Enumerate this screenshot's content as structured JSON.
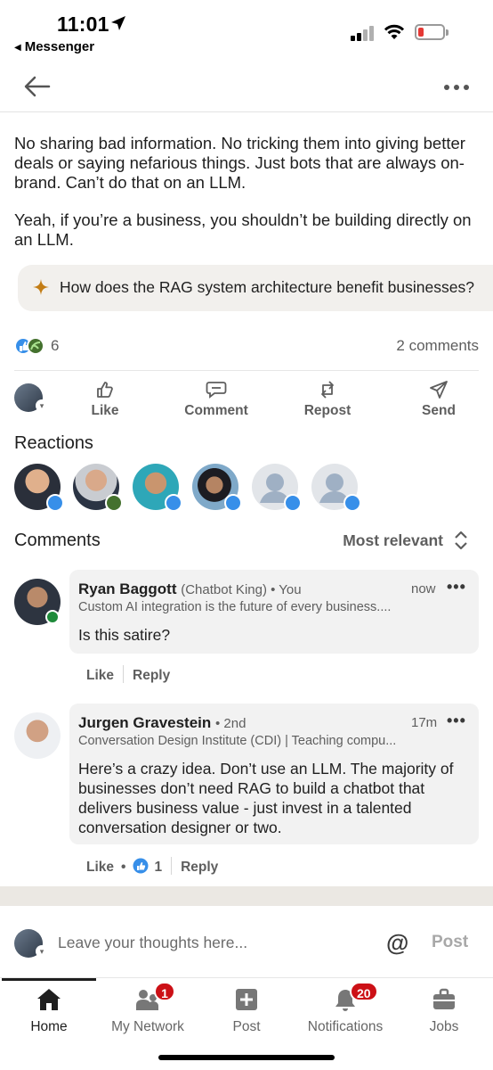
{
  "status_bar": {
    "time": "11:01",
    "back_app": "Messenger"
  },
  "post": {
    "paragraphs": [
      "No sharing bad information. No tricking them into giving better deals or saying nefarious things. Just bots that are always on-brand. Can’t do that on an LLM.",
      "Yeah, if you’re a business, you shouldn’t be building directly on an LLM."
    ],
    "ai_suggestion": "How does the RAG system architecture benefit businesses?",
    "reaction_count": "6",
    "comment_count": "2 comments"
  },
  "actions": {
    "like": "Like",
    "comment": "Comment",
    "repost": "Repost",
    "send": "Send"
  },
  "reactions": {
    "title": "Reactions"
  },
  "comments_section": {
    "title": "Comments",
    "sort_label": "Most relevant",
    "comments": [
      {
        "name": "Ryan Baggott",
        "meta": "(Chatbot King) • You",
        "time": "now",
        "headline": "Custom AI integration is the future of every business....",
        "body": "Is this satire?",
        "like": "Like",
        "reply": "Reply"
      },
      {
        "name": "Jurgen Gravestein",
        "meta": "• 2nd",
        "time": "17m",
        "headline": "Conversation Design Institute (CDI) | Teaching compu...",
        "body": "Here’s a crazy idea. Don’t use an LLM. The majority of businesses don’t need RAG to build a chatbot that delivers business value - just invest in a talented conversation designer or two.",
        "like": "Like",
        "like_count": "1",
        "reply": "Reply"
      }
    ]
  },
  "composer": {
    "placeholder": "Leave your thoughts here...",
    "at_symbol": "@",
    "post_label": "Post"
  },
  "tabbar": {
    "home": "Home",
    "network": "My Network",
    "network_badge": "1",
    "post": "Post",
    "notifications": "Notifications",
    "notifications_badge": "20",
    "jobs": "Jobs"
  },
  "colors": {
    "accent": "#0a66c2",
    "badge": "#cc1016",
    "online": "#1e8a3a",
    "spark": "#c37d16"
  }
}
